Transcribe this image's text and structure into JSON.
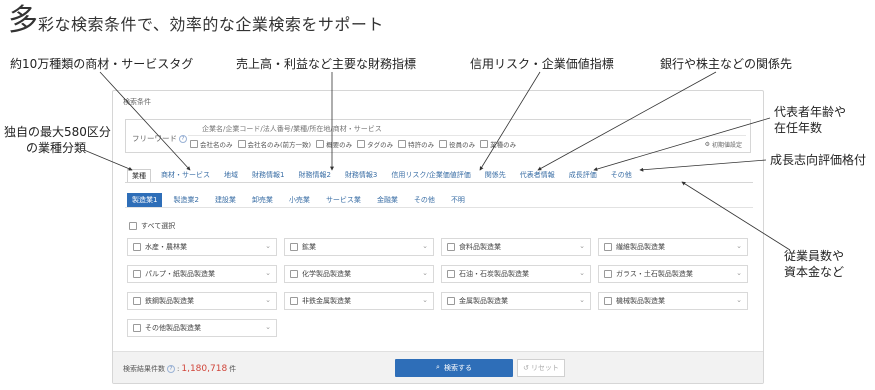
{
  "headline": {
    "big": "多",
    "rest": "彩な検索条件で、効率的な企業検索をサポート"
  },
  "callouts": {
    "tags": "約10万種類の商材・サービスタグ",
    "financial": "売上高・利益など主要な財務指標",
    "credit": "信用リスク・企業価値指標",
    "relations": "銀行や株主などの関係先",
    "industry_line1": "独自の最大580区分",
    "industry_line2": "の業種分類",
    "rep_line1": "代表者年齢や",
    "rep_line2": "在任年数",
    "growth": "成長志向評価格付",
    "emp_line1": "従業員数や",
    "emp_line2": "資本金など"
  },
  "panel": {
    "title": "検索条件",
    "keyword": {
      "label": "フリーワード",
      "help_icon": "help-icon",
      "placeholder": "企業名/企業コード/法人番号/業種/所在地/商材・サービス",
      "checks": [
        "会社名のみ",
        "会社名のみ(前方一致)",
        "概要のみ",
        "タグのみ",
        "特許のみ",
        "役員のみ",
        "業種のみ"
      ],
      "reset_label": "初期値設定"
    },
    "tabs": [
      "業種",
      "商材・サービス",
      "地域",
      "財務情報1",
      "財務情報2",
      "財務情報3",
      "信用リスク/企業価値評価",
      "関係先",
      "代表者情報",
      "成長評価",
      "その他"
    ],
    "active_tab": "業種",
    "subtabs": [
      "製造業1",
      "製造業2",
      "建設業",
      "卸売業",
      "小売業",
      "サービス業",
      "金融業",
      "その他",
      "不明"
    ],
    "active_subtab": "製造業1",
    "select_all": "すべて選択",
    "industries": [
      "水産・農林業",
      "鉱業",
      "食料品製造業",
      "繊維製品製造業",
      "パルプ・紙製品製造業",
      "化学製品製造業",
      "石油・石炭製品製造業",
      "ガラス・土石製品製造業",
      "鉄鋼製品製造業",
      "非鉄金属製造業",
      "金属製品製造業",
      "機械製品製造業",
      "その他製品製造業"
    ],
    "footer": {
      "count_label": "検索結果件数",
      "count_value": "1,180,718",
      "count_unit": "件",
      "search_label": "検索する",
      "reset_label": "リセット"
    }
  },
  "colors": {
    "accent": "#2e6eb8",
    "link": "#3a6ea5",
    "count": "#d0453a"
  }
}
